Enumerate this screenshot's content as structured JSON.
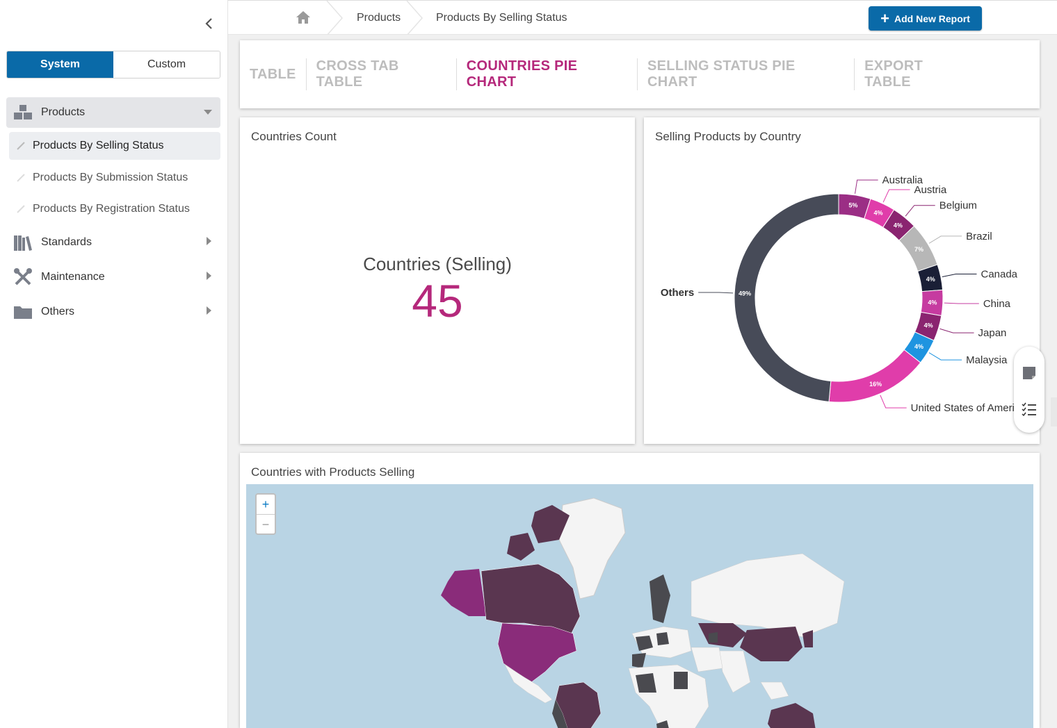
{
  "sidebar": {
    "segments": [
      "System",
      "Custom"
    ],
    "sections": [
      {
        "label": "Products",
        "icon": "boxes-icon"
      },
      {
        "label": "Standards",
        "icon": "books-icon"
      },
      {
        "label": "Maintenance",
        "icon": "tools-icon"
      },
      {
        "label": "Others",
        "icon": "folder-icon"
      }
    ],
    "sub_items": [
      "Products By Selling Status",
      "Products By Submission Status",
      "Products By Registration Status"
    ]
  },
  "header": {
    "breadcrumb": [
      "Products",
      "Products By Selling Status"
    ],
    "add_button": "Add New Report"
  },
  "tabs": [
    "TABLE",
    "CROSS TAB TABLE",
    "COUNTRIES PIE CHART",
    "SELLING STATUS PIE CHART",
    "EXPORT TABLE"
  ],
  "active_tab": "COUNTRIES PIE CHART",
  "count_card": {
    "title": "Countries Count",
    "label": "Countries (Selling)",
    "value": "45"
  },
  "pie_card": {
    "title": "Selling Products by Country"
  },
  "map_card": {
    "title": "Countries with Products Selling",
    "zoom_in": "+",
    "zoom_out": "−"
  },
  "colors": {
    "accent": "#b5287b",
    "primary": "#0a6aa8",
    "map_selling": "#5a3650",
    "map_usa": "#8a2c7a",
    "map_grey": "#4a4a4f",
    "water": "#b9d4e4"
  },
  "chart_data": {
    "type": "pie",
    "title": "Selling Products by Country",
    "donut": true,
    "slices": [
      {
        "label": "Australia",
        "value": 5,
        "pct_label": "5%",
        "color": "#9b2e85"
      },
      {
        "label": "Austria",
        "value": 4,
        "pct_label": "4%",
        "color": "#e03daa"
      },
      {
        "label": "Belgium",
        "value": 4,
        "pct_label": "4%",
        "color": "#8a2470"
      },
      {
        "label": "Brazil",
        "value": 7,
        "pct_label": "7%",
        "color": "#b7b7b7"
      },
      {
        "label": "Canada",
        "value": 4,
        "pct_label": "4%",
        "color": "#1a1f36"
      },
      {
        "label": "China",
        "value": 4,
        "pct_label": "4%",
        "color": "#c63ba0"
      },
      {
        "label": "Japan",
        "value": 4,
        "pct_label": "4%",
        "color": "#8a2470"
      },
      {
        "label": "Malaysia",
        "value": 4,
        "pct_label": "4%",
        "color": "#1e94e0"
      },
      {
        "label": "United States of America",
        "value": 16,
        "pct_label": "16%",
        "color": "#e03daa"
      },
      {
        "label": "Others",
        "value": 49,
        "pct_label": "49%",
        "color": "#474b58"
      }
    ]
  }
}
